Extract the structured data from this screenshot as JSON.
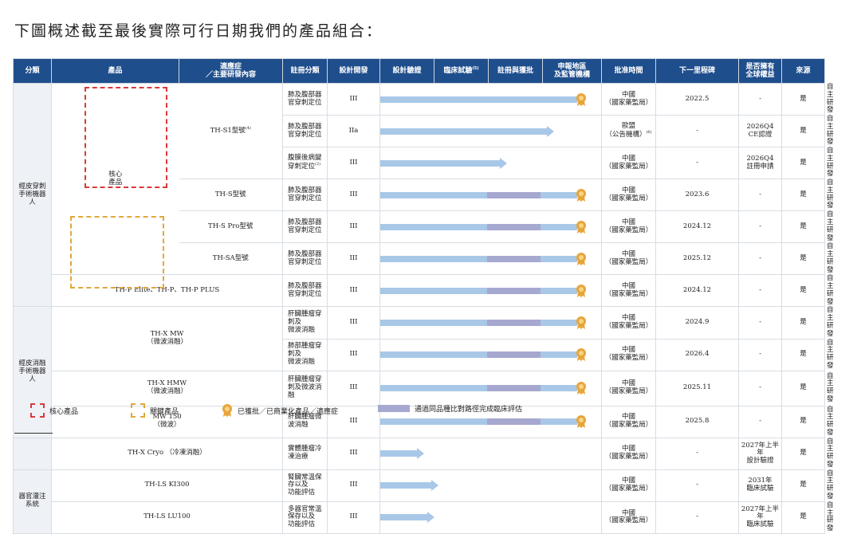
{
  "heading": "下圖概述截至最後實際可行日期我們的產品組合：",
  "headers": [
    "分類",
    "產品",
    "適應症\n／主要研發內容",
    "註冊分類",
    "設計開發",
    "設計驗證",
    "臨床試驗",
    "註冊與獲批",
    "申報地區\n及監管機構",
    "批准時間",
    "下一里程碑",
    "是否擁有\n全球權益",
    "來源"
  ],
  "header_sup": "(5)",
  "groups": [
    "經皮穿刺\n手術機器\n人",
    "經皮消融\n手術機器\n人",
    "器官灌注\n系統"
  ],
  "subgroup": "核心\n產品",
  "rows": [
    {
      "product": "TH-S1型號",
      "sup": "(4)",
      "indication": "肺及腹部器官穿刺定位",
      "reg": "III",
      "region": "中國\n（國家藥監局）",
      "approval": "2022.5",
      "next": "-",
      "global": "是",
      "source": "自主研發",
      "progress": 0.92,
      "compare": null,
      "approved": true
    },
    {
      "product": "",
      "sup": "",
      "indication": "肺及腹部器官穿刺定位",
      "reg": "IIa",
      "region": "歐盟\n（公告機構）",
      "region_sup": "(6)",
      "approval": "-",
      "next": "2026Q4\nCE認證",
      "global": "是",
      "source": "自主研發",
      "progress": 0.78,
      "compare": null,
      "approved": false
    },
    {
      "product": "",
      "sup": "",
      "indication": "腹膜後病變穿刺定位",
      "ind_sup": "(2)",
      "reg": "III",
      "region": "中國\n（國家藥監局）",
      "approval": "-",
      "next": "2026Q4\n註冊申請",
      "global": "是",
      "source": "自主研發",
      "progress": 0.56,
      "compare": null,
      "approved": false
    },
    {
      "product": "TH-S型號",
      "sup": "",
      "indication": "肺及腹部器官穿刺定位",
      "reg": "III",
      "region": "中國\n（國家藥監局）",
      "approval": "2023.6",
      "next": "-",
      "global": "是",
      "source": "自主研發",
      "progress": 0.92,
      "compare": [
        0.5,
        0.75
      ],
      "approved": true
    },
    {
      "product": "TH-S Pro型號",
      "sup": "",
      "indication": "肺及腹部器官穿刺定位",
      "reg": "III",
      "region": "中國\n（國家藥監局）",
      "approval": "2024.12",
      "next": "-",
      "global": "是",
      "source": "自主研發",
      "progress": 0.92,
      "compare": [
        0.5,
        0.75
      ],
      "approved": true
    },
    {
      "product": "TH-SA型號",
      "sup": "",
      "indication": "肺及腹部器官穿刺定位",
      "reg": "III",
      "region": "中國\n（國家藥監局）",
      "approval": "2025.12",
      "next": "-",
      "global": "是",
      "source": "自主研發",
      "progress": 0.92,
      "compare": [
        0.5,
        0.75
      ],
      "approved": true
    },
    {
      "product": "TH-P Elite、TH-P、TH-P PLUS",
      "sup": "",
      "indication": "肺及腹部器官穿刺定位",
      "reg": "III",
      "region": "中國\n（國家藥監局）",
      "approval": "2024.12",
      "next": "-",
      "global": "是",
      "source": "自主研發",
      "progress": 0.92,
      "compare": [
        0.5,
        0.75
      ],
      "approved": true
    },
    {
      "product": "TH-X MW\n（微波消融）",
      "sup": "",
      "indication": "肝臟腫瘤穿刺及\n微波消融",
      "reg": "III",
      "region": "中國\n（國家藥監局）",
      "approval": "2024.9",
      "next": "-",
      "global": "是",
      "source": "自主研發",
      "progress": 0.92,
      "compare": [
        0.5,
        0.75
      ],
      "approved": true
    },
    {
      "product": "",
      "sup": "",
      "indication": "肺部腫瘤穿刺及\n微波消融",
      "reg": "III",
      "region": "中國\n（國家藥監局）",
      "approval": "2026.4",
      "next": "-",
      "global": "是",
      "source": "自主研發",
      "progress": 0.92,
      "compare": [
        0.5,
        0.75
      ],
      "approved": true
    },
    {
      "product": "TH-X HMW\n（微波消融）",
      "sup": "",
      "indication": "肝臟腫瘤穿刺及微波消融",
      "reg": "III",
      "region": "中國\n（國家藥監局）",
      "approval": "2025.11",
      "next": "-",
      "global": "是",
      "source": "自主研發",
      "progress": 0.92,
      "compare": [
        0.5,
        0.75
      ],
      "approved": true
    },
    {
      "product": "MW 150\n（微波）",
      "sup": "",
      "indication": "肝臟腫瘤微波消融",
      "reg": "III",
      "region": "中國\n（國家藥監局）",
      "approval": "2025.8",
      "next": "-",
      "global": "是",
      "source": "自主研發",
      "progress": 0.92,
      "compare": [
        0.5,
        0.75
      ],
      "approved": true
    },
    {
      "product": "TH-X Cryo （冷凍消融）",
      "sup": "",
      "indication": "實體腫瘤冷凍治療",
      "reg": "III",
      "region": "中國\n（國家藥監局）",
      "approval": "-",
      "next": "2027年上半年\n設計驗證",
      "global": "是",
      "source": "自主研發",
      "progress": 0.17,
      "compare": null,
      "approved": false
    },
    {
      "product": "TH-LS KI300",
      "sup": "",
      "indication": "腎臟常溫保存以及\n功能評估",
      "reg": "III",
      "region": "中國\n（國家藥監局）",
      "approval": "-",
      "next": "2031年\n臨床試驗",
      "global": "是",
      "source": "自主研發",
      "progress": 0.24,
      "compare": null,
      "approved": false
    },
    {
      "product": "TH-LS LU100",
      "sup": "",
      "indication": "多器官常溫保存以及\n功能評估",
      "reg": "III",
      "region": "中國\n（國家藥監局）",
      "approval": "-",
      "next": "2027年上半年\n臨床試驗",
      "global": "是",
      "source": "自主研發",
      "progress": 0.22,
      "compare": null,
      "approved": false
    }
  ],
  "legend": {
    "core": "核心產品",
    "key": "關鍵產品",
    "approved": "已獲批／已商業化產品／適應症",
    "compare": "通過同品種比對路徑完成臨床評估"
  },
  "colors": {
    "header": "#1f4e8c",
    "progress": "#a9c8e8",
    "compare": "#a6a8cf",
    "core": "#d83a3a",
    "key": "#e0a83a",
    "medal": "#e8a53a"
  }
}
